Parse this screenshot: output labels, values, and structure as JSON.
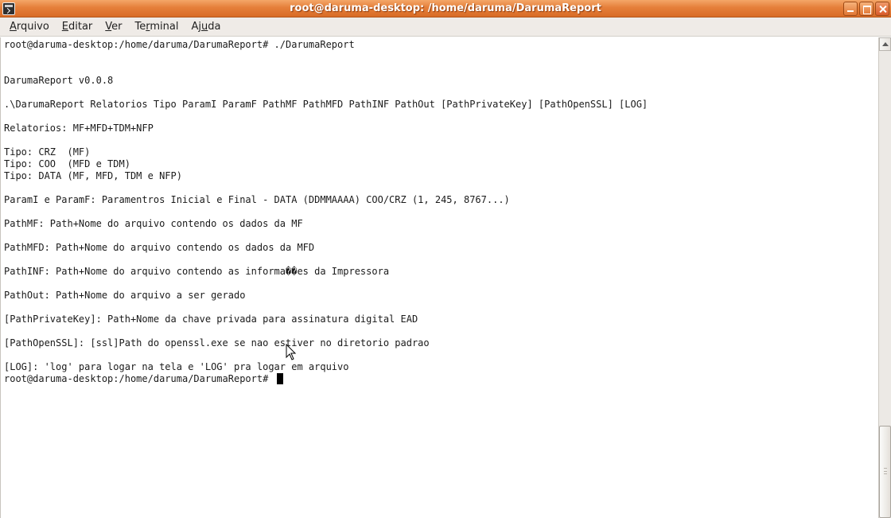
{
  "window": {
    "title": "root@daruma-desktop: /home/daruma/DarumaReport"
  },
  "menubar": {
    "items": [
      {
        "mnemonic": "A",
        "rest": "rquivo"
      },
      {
        "mnemonic": "E",
        "rest": "ditar"
      },
      {
        "mnemonic": "V",
        "rest": "er"
      },
      {
        "pre": "Te",
        "mnemonic": "r",
        "rest": "minal"
      },
      {
        "pre": "Aj",
        "mnemonic": "u",
        "rest": "da"
      }
    ]
  },
  "terminal": {
    "lines": [
      "root@daruma-desktop:/home/daruma/DarumaReport# ./DarumaReport",
      "",
      "",
      "DarumaReport v0.0.8",
      "",
      ".\\DarumaReport Relatorios Tipo ParamI ParamF PathMF PathMFD PathINF PathOut [PathPrivateKey] [PathOpenSSL] [LOG]",
      "",
      "Relatorios: MF+MFD+TDM+NFP",
      "",
      "Tipo: CRZ  (MF)",
      "Tipo: COO  (MFD e TDM)",
      "Tipo: DATA (MF, MFD, TDM e NFP)",
      "",
      "ParamI e ParamF: Paramentros Inicial e Final - DATA (DDMMAAAA) COO/CRZ (1, 245, 8767...)",
      "",
      "PathMF: Path+Nome do arquivo contendo os dados da MF",
      "",
      "PathMFD: Path+Nome do arquivo contendo os dados da MFD",
      "",
      "PathINF: Path+Nome do arquivo contendo as informa��es da Impressora",
      "",
      "PathOut: Path+Nome do arquivo a ser gerado",
      "",
      "[PathPrivateKey]: Path+Nome da chave privada para assinatura digital EAD",
      "",
      "[PathOpenSSL]: [ssl]Path do openssl.exe se nao estiver no diretorio padrao",
      "",
      "[LOG]: 'log' para logar na tela e 'LOG' pra logar em arquivo"
    ],
    "prompt": "root@daruma-desktop:/home/daruma/DarumaReport# "
  },
  "colors": {
    "titlebar": "#e57f3a",
    "menubar": "#efebe7",
    "terminal_bg": "#ffffff",
    "terminal_fg": "#1a1a1a"
  },
  "icons": [
    "terminal-app-icon",
    "minimize-icon",
    "maximize-icon",
    "close-icon",
    "scroll-up-arrow-icon",
    "mouse-pointer-icon"
  ]
}
